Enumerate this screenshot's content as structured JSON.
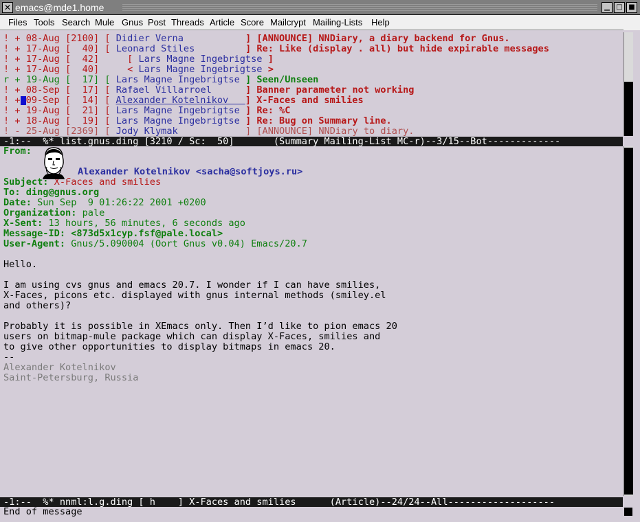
{
  "window": {
    "title": "emacs@mde1.home"
  },
  "menu": [
    "Files",
    "Tools",
    "Search",
    "Mule",
    "Gnus",
    "Post",
    "Threads",
    "Article",
    "Score",
    "Mailcrypt",
    "Mailing-Lists",
    "Help"
  ],
  "summary": {
    "lines": [
      {
        "mark": "!",
        "sign": "+",
        "date": "08-Aug",
        "lines": "2100",
        "open": "[",
        "author": "Didier Verna",
        "close": "]",
        "subject": "[ANNOUNCE] NNDiary, a diary backend for Gnus.",
        "style": "normal"
      },
      {
        "mark": "!",
        "sign": "+",
        "date": "17-Aug",
        "lines": "  40",
        "open": "[",
        "author": "Leonard Stiles",
        "close": "]",
        "subject": "Re: Like (display . all) but hide expirable messages",
        "style": "normal"
      },
      {
        "mark": "!",
        "sign": "+",
        "date": "17-Aug",
        "lines": "  42",
        "open": "    [",
        "author": "Lars Magne Ingebrigtse",
        "close": "]",
        "subject": "",
        "style": "normal"
      },
      {
        "mark": "!",
        "sign": "+",
        "date": "17-Aug",
        "lines": "  40",
        "open": "    <",
        "author": "Lars Magne Ingebrigtse",
        "close": ">",
        "subject": "",
        "style": "normal"
      },
      {
        "mark": "r",
        "sign": "+",
        "date": "19-Aug",
        "lines": "  17",
        "open": "[",
        "author": "Lars Magne Ingebrigtse",
        "close": "]",
        "subject": "Seen/Unseen",
        "style": "green"
      },
      {
        "mark": "!",
        "sign": "+",
        "date": "08-Sep",
        "lines": "  17",
        "open": "[",
        "author": "Rafael Villarroel",
        "close": "]",
        "subject": "Banner parameter not working",
        "style": "normal"
      },
      {
        "mark": "!",
        "sign": "+",
        "date": "09-Sep",
        "lines": "  14",
        "open": "[",
        "author": "Alexander Kotelnikov",
        "close": "]",
        "subject": "X-Faces and smilies",
        "style": "current"
      },
      {
        "mark": "!",
        "sign": "+",
        "date": "19-Aug",
        "lines": "  21",
        "open": "[",
        "author": "Lars Magne Ingebrigtse",
        "close": "]",
        "subject": "Re: %C",
        "style": "normal"
      },
      {
        "mark": "!",
        "sign": "+",
        "date": "18-Aug",
        "lines": "  19",
        "open": "[",
        "author": "Lars Magne Ingebrigtse",
        "close": "]",
        "subject": "Re: Bug on Summary line.",
        "style": "normal"
      },
      {
        "mark": "!",
        "sign": "-",
        "date": "25-Aug",
        "lines": "2369",
        "open": "[",
        "author": "Jody Klymak",
        "close": "]",
        "subject": "[ANNOUNCE] NNDiary to diary.",
        "style": "muted"
      }
    ]
  },
  "summary_modeline": "-1:--  %* list.gnus.ding [3210 / Sc:  50]       (Summary Mailing-List MC-r)--3/15--Bot-------------",
  "article": {
    "headers": [
      {
        "name": "From:",
        "value": ""
      },
      {
        "name": "",
        "value": "Alexander Kotelnikov <sacha@softjoys.ru>",
        "kind": "from"
      },
      {
        "name": "Subject:",
        "value": "X-Faces and smilies",
        "kind": "subject"
      },
      {
        "name": "To:",
        "value": "ding@gnus.org",
        "kind": "to"
      },
      {
        "name": "Date:",
        "value": "Sun Sep  9 01:26:22 2001 +0200"
      },
      {
        "name": "Organization:",
        "value": "pale"
      },
      {
        "name": "X-Sent:",
        "value": "13 hours, 56 minutes, 6 seconds ago"
      },
      {
        "name": "Message-ID:",
        "value": "<873d5x1cyp.fsf@pale.local>",
        "kind": "bold"
      },
      {
        "name": "User-Agent:",
        "value": "Gnus/5.090004 (Oort Gnus v0.04) Emacs/20.7"
      }
    ],
    "body": [
      "Hello.",
      "",
      "I am using cvs gnus and emacs 20.7. I wonder if I can have smilies,",
      "X-Faces, picons etc. displayed with gnus internal methods (smiley.el",
      "and others)?",
      "",
      "Probably it is possible in XEmacs only. Then I’d like to pion emacs 20",
      "users on bitmap-mule package which can display X-Faces, smilies and",
      "to give other opportunities to display bitmaps in emacs 20.",
      "--"
    ],
    "signature": [
      "Alexander Kotelnikov",
      "Saint-Petersburg, Russia"
    ]
  },
  "article_modeline": "-1:--  %* nnml:l.g.ding [ h    ] X-Faces and smilies      (Article)--24/24--All-------------------",
  "minibuffer": "End of message",
  "icons": {
    "close": "close-icon",
    "minimize": "minimize-icon",
    "maximize": "maximize-icon"
  }
}
